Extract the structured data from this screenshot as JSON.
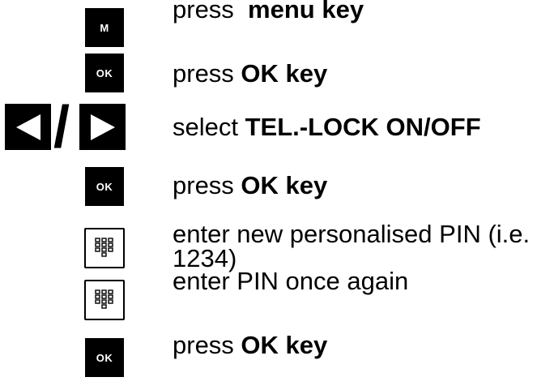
{
  "steps": [
    {
      "key_label": "M",
      "verb": "press ",
      "bold": "menu key"
    },
    {
      "key_label": "OK",
      "verb": "press ",
      "bold": "OK key"
    },
    {
      "arrow_separator": "/",
      "verb": "select ",
      "bold": "TEL.-LOCK ON/OFF"
    },
    {
      "key_label": "OK",
      "verb": "press ",
      "bold": "OK key"
    },
    {
      "icon": "keypad-icon",
      "line1": "enter new personalised PIN (i.e.",
      "line2": "1234)"
    },
    {
      "icon": "keypad-icon",
      "text": "enter PIN once again"
    },
    {
      "key_label": "OK",
      "verb": "press ",
      "bold": "OK key"
    }
  ]
}
